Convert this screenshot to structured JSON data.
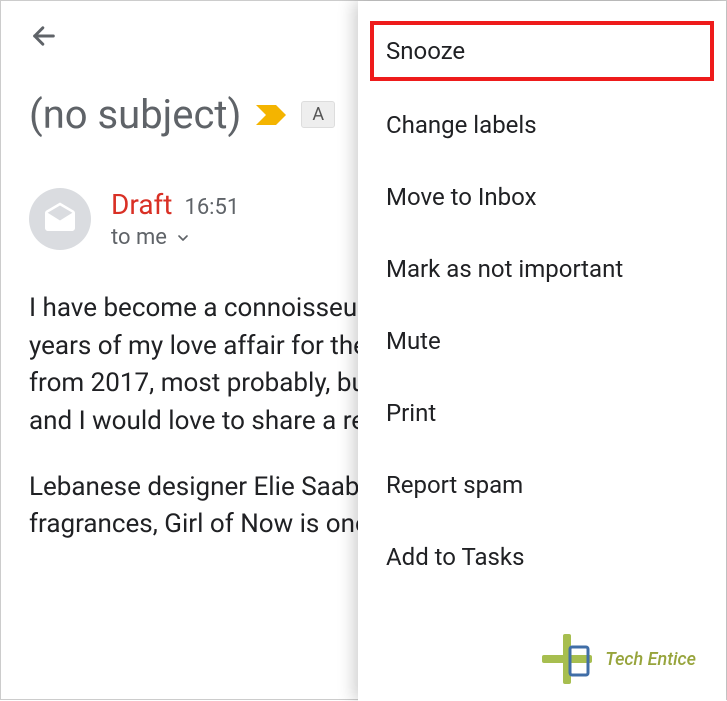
{
  "header": {
    "back_icon": "arrow-left"
  },
  "email": {
    "subject": "(no subject)",
    "label_visible": "A",
    "sender": "Draft",
    "timestamp": "16:51",
    "recipient": "to me",
    "body_p1": "I have become a connoisseur of good fragrances after years of my love affair for them. Elie Saab Girl of Now is from 2017, most probably,  but it still resides in my closet and I would love to share a review with you.",
    "body_p2": "Lebanese designer Elie Saab has a huge lineup of fragrances, Girl of Now is one.. There are three editions of"
  },
  "menu": {
    "items": [
      "Snooze",
      "Change labels",
      "Move to Inbox",
      "Mark as not important",
      "Mute",
      "Print",
      "Report spam",
      "Add to Tasks"
    ]
  },
  "watermark": {
    "text": "Tech Entice"
  }
}
